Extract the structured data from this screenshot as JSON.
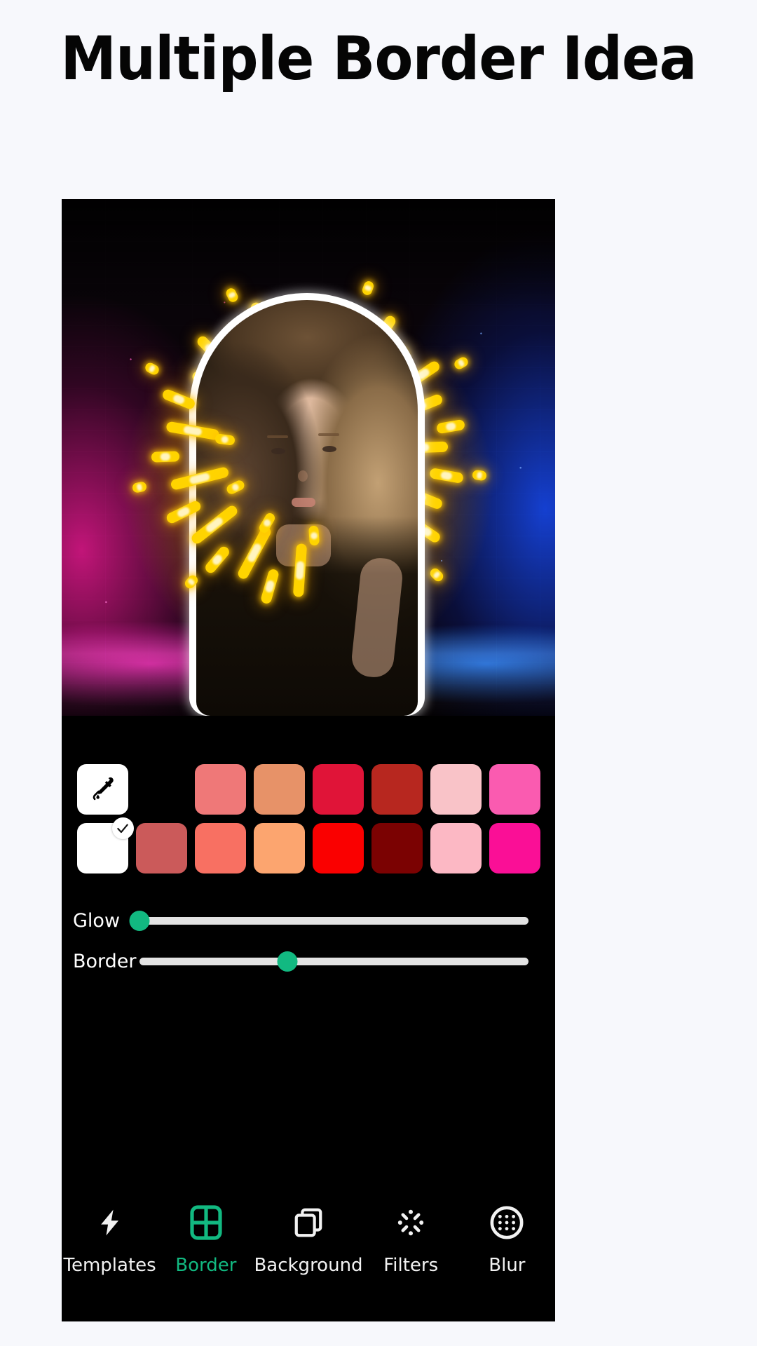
{
  "heading": {
    "title": "Multiple Border Idea"
  },
  "theme": {
    "page_bg": "#f7f8fc",
    "panel_bg": "#000000",
    "accent": "#12b981",
    "slider_track": "#e3e3e3",
    "neon_ray": "#ffd400"
  },
  "editor": {
    "photo": {
      "alt": "Portrait of a woman with neon sunburst border on neon brick wall",
      "background_colors": [
        "#e2188c",
        "#d69614",
        "#1646e6"
      ],
      "sticker_border_color": "#ffffff",
      "ray_color": "#ffd400"
    },
    "swatch_rows": [
      {
        "row_name": "swatch-row-1",
        "cells": [
          {
            "name": "eyedropper",
            "type": "eyedropper",
            "icon": "eyedropper-icon",
            "color": "#ffffff"
          },
          {
            "name": "spacer",
            "type": "empty",
            "color": null
          },
          {
            "name": "swatch-salmon",
            "type": "color",
            "color": "#ef7878"
          },
          {
            "name": "swatch-peach",
            "type": "color",
            "color": "#e79268"
          },
          {
            "name": "swatch-crimson",
            "type": "color",
            "color": "#e01438"
          },
          {
            "name": "swatch-brick-red",
            "type": "color",
            "color": "#b7271f"
          },
          {
            "name": "swatch-light-pink",
            "type": "color",
            "color": "#f9c3c8"
          },
          {
            "name": "swatch-hot-pink",
            "type": "color",
            "color": "#fa5bb0"
          }
        ]
      },
      {
        "row_name": "swatch-row-2",
        "cells": [
          {
            "name": "swatch-white",
            "type": "color",
            "color": "#ffffff",
            "selected": true
          },
          {
            "name": "swatch-dusty-rose",
            "type": "color",
            "color": "#cb5a5a"
          },
          {
            "name": "swatch-coral",
            "type": "color",
            "color": "#f87062"
          },
          {
            "name": "swatch-light-orange",
            "type": "color",
            "color": "#fca56f"
          },
          {
            "name": "swatch-pure-red",
            "type": "color",
            "color": "#fa0000"
          },
          {
            "name": "swatch-dark-maroon",
            "type": "color",
            "color": "#7b0202"
          },
          {
            "name": "swatch-pastel-pink",
            "type": "color",
            "color": "#fcb8c4"
          },
          {
            "name": "swatch-magenta",
            "type": "color",
            "color": "#fa0f96"
          }
        ]
      }
    ],
    "sliders": [
      {
        "name": "glow-slider",
        "label": "Glow",
        "value": 0,
        "min": 0,
        "max": 100
      },
      {
        "name": "border-slider",
        "label": "Border",
        "value": 38,
        "min": 0,
        "max": 100
      }
    ],
    "toolbar": [
      {
        "name": "tab-templates",
        "label": "Templates",
        "icon": "lightning-bolt-icon",
        "active": false
      },
      {
        "name": "tab-border",
        "label": "Border",
        "icon": "grid-icon",
        "active": true
      },
      {
        "name": "tab-background",
        "label": "Background",
        "icon": "layers-icon",
        "active": false
      },
      {
        "name": "tab-filters",
        "label": "Filters",
        "icon": "sparkle-burst-icon",
        "active": false
      },
      {
        "name": "tab-blur",
        "label": "Blur",
        "icon": "dotted-circle-icon",
        "active": false
      }
    ]
  }
}
